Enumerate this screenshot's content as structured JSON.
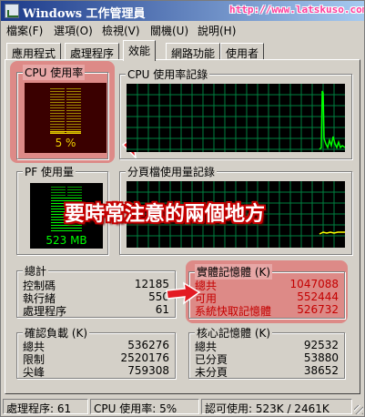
{
  "window": {
    "title": "Windows 工作管理員",
    "watermark_url": "http://www.latskuso.com"
  },
  "menu": {
    "items": [
      "檔案(F)",
      "選項(O)",
      "檢視(V)",
      "關機(U)",
      "說明(H)"
    ]
  },
  "tabs": {
    "items": [
      "應用程式",
      "處理程序",
      "效能",
      "網路功能",
      "使用者"
    ],
    "active_index": 2
  },
  "cpu_usage": {
    "label": "CPU 使用率",
    "value_text": "5 %",
    "level_percent": 5
  },
  "cpu_history": {
    "label": "CPU 使用率記錄"
  },
  "pf_usage": {
    "label": "PF 使用量",
    "value_text": "523 MB"
  },
  "pf_history": {
    "label": "分頁檔使用量記錄"
  },
  "annotation": {
    "text": "要時常注意的兩個地方"
  },
  "totals": {
    "label": "總計",
    "rows": [
      {
        "label": "控制碼",
        "value": "12185"
      },
      {
        "label": "執行緒",
        "value": "550"
      },
      {
        "label": "處理程序",
        "value": "61"
      }
    ]
  },
  "physical_memory": {
    "label": "實體記憶體 (K)",
    "rows": [
      {
        "label": "總共",
        "value": "1047088"
      },
      {
        "label": "可用",
        "value": "552444"
      },
      {
        "label": "系統快取記憶體",
        "value": "526732"
      }
    ]
  },
  "commit_charge": {
    "label": "確認負載 (K)",
    "rows": [
      {
        "label": "總共",
        "value": "536276"
      },
      {
        "label": "限制",
        "value": "2520176"
      },
      {
        "label": "尖峰",
        "value": "759308"
      }
    ]
  },
  "kernel_memory": {
    "label": "核心記憶體 (K)",
    "rows": [
      {
        "label": "總共",
        "value": "92532"
      },
      {
        "label": "已分頁",
        "value": "53880"
      },
      {
        "label": "未分頁",
        "value": "38652"
      }
    ]
  },
  "status": {
    "processes": "處理程序: 61",
    "cpu": "CPU 使用率: 5%",
    "commit": "認可使用: 523K / 2461K"
  },
  "colors": {
    "highlight": "#e26464",
    "graph_line": "#00ff00",
    "graph_grid": "#008040",
    "annotation": "#c40000"
  }
}
